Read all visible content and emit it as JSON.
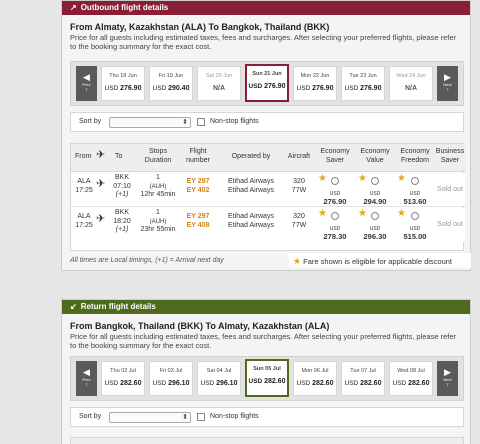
{
  "outbound": {
    "header": "Outbound flight details",
    "header_arrow": "↗",
    "route": "From Almaty, Kazakhstan (ALA) To Bangkok, Thailand (BKK)",
    "desc": "Price for all guests including estimated taxes, fees and surcharges. After selecting your preferred flights, please refer to the booking summary for the exact cost.",
    "prev": "Prev",
    "next": "Next",
    "prev_num": "7",
    "next_num": "7",
    "days": [
      {
        "date": "Thu 18 Jun",
        "cur": "USD",
        "price": "276.90"
      },
      {
        "date": "Fri 19 Jun",
        "cur": "USD",
        "price": "290.40"
      },
      {
        "date": "Sat 20 Jun",
        "cur": "",
        "price": "N/A"
      },
      {
        "date": "Sun 21 Jun",
        "cur": "USD",
        "price": "276.90"
      },
      {
        "date": "Mon 22 Jun",
        "cur": "USD",
        "price": "276.90"
      },
      {
        "date": "Tue 23 Jun",
        "cur": "USD",
        "price": "276.90"
      },
      {
        "date": "Wed 24 Jun",
        "cur": "",
        "price": "N/A"
      }
    ],
    "sort_label": "Sort by",
    "nonstop_label": "Non-stop flights",
    "columns": {
      "from": "From",
      "to": "To",
      "stops": "Stops",
      "duration": "Duration",
      "flight": "Flight",
      "number": "number",
      "operated": "Operated by",
      "aircraft": "Aircraft",
      "eco_saver": "Economy",
      "eco_saver2": "Saver",
      "eco_value": "Economy",
      "eco_value2": "Value",
      "eco_freedom": "Economy",
      "eco_freedom2": "Freedom",
      "biz": "Business",
      "biz2": "Saver"
    },
    "rows": [
      {
        "from": "ALA",
        "dep": "17:25",
        "to": "BKK",
        "arr": "07:10",
        "plus": "(+1)",
        "stops": "1",
        "via": "(AUH)",
        "dur": "12hr 45min",
        "f1": "EY 297",
        "f2": "EY 402",
        "op1": "Etihad Airways",
        "op2": "Etihad Airways",
        "ac1": "320",
        "ac2": "77W",
        "saver_cur": "USD",
        "saver": "276.90",
        "value_cur": "USD",
        "value": "294.90",
        "freedom_cur": "USD",
        "freedom": "513.60",
        "biz": "Sold out"
      },
      {
        "from": "ALA",
        "dep": "17:25",
        "to": "BKK",
        "arr": "18:20",
        "plus": "(+1)",
        "stops": "1",
        "via": "(AUH)",
        "dur": "23hr 55min",
        "f1": "EY 297",
        "f2": "EY 408",
        "op1": "Etihad Airways",
        "op2": "Etihad Airways",
        "ac1": "320",
        "ac2": "77W",
        "saver_cur": "USD",
        "saver": "278.30",
        "value_cur": "USD",
        "value": "296.30",
        "freedom_cur": "USD",
        "freedom": "515.00",
        "biz": "Sold out"
      }
    ],
    "footnote": "All times are Local timings, (+1) = Arrival next day",
    "eligible": "Fare shown is eligible for applicable discount"
  },
  "return": {
    "header": "Return flight details",
    "header_arrow": "↙",
    "route": "From Bangkok, Thailand (BKK) To Almaty, Kazakhstan (ALA)",
    "desc": "Price for all guests including estimated taxes, fees and surcharges. After selecting your preferred flights, please refer to the booking summary for the exact cost.",
    "prev": "Prev",
    "next": "Next",
    "prev_num": "7",
    "next_num": "7",
    "days": [
      {
        "date": "Thu 02 Jul",
        "cur": "USD",
        "price": "282.60"
      },
      {
        "date": "Fri 03 Jul",
        "cur": "USD",
        "price": "296.10"
      },
      {
        "date": "Sat 04 Jul",
        "cur": "USD",
        "price": "296.10"
      },
      {
        "date": "Sun 05 Jul",
        "cur": "USD",
        "price": "282.60"
      },
      {
        "date": "Mon 06 Jul",
        "cur": "USD",
        "price": "282.60"
      },
      {
        "date": "Tue 07 Jul",
        "cur": "USD",
        "price": "282.60"
      },
      {
        "date": "Wed 08 Jul",
        "cur": "USD",
        "price": "282.60"
      }
    ],
    "sort_label": "Sort by",
    "nonstop_label": "Non-stop flights"
  },
  "colors": {
    "outbound": "#8a1e34",
    "return": "#4e6a1c",
    "fare_code": "#d0821b",
    "star": "#e8a812"
  }
}
